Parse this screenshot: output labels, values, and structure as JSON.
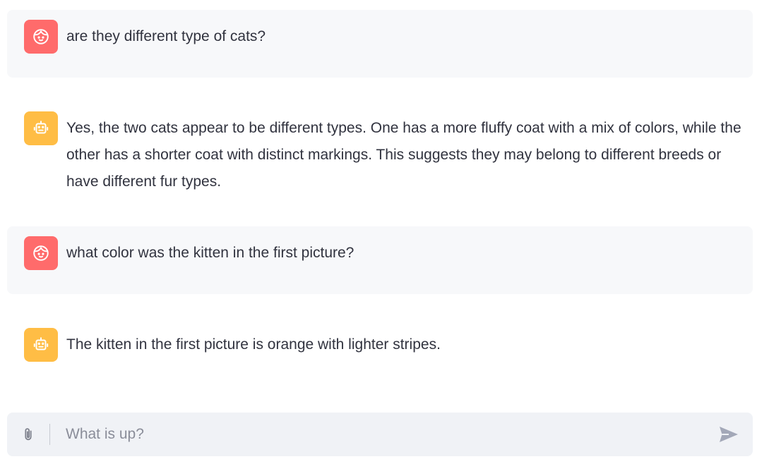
{
  "messages": [
    {
      "role": "user",
      "avatar_icon": "user-face-icon",
      "text": "are they different type of cats?"
    },
    {
      "role": "assistant",
      "avatar_icon": "robot-icon",
      "text": "Yes, the two cats appear to be different types. One has a more fluffy coat with a mix of colors, while the other has a shorter coat with distinct markings. This suggests they may belong to different breeds or have different fur types."
    },
    {
      "role": "user",
      "avatar_icon": "user-face-icon",
      "text": "what color was the kitten in the first picture?"
    },
    {
      "role": "assistant",
      "avatar_icon": "robot-icon",
      "text": "The kitten in the first picture is orange with lighter stripes."
    }
  ],
  "composer": {
    "placeholder": "What is up?",
    "value": "",
    "attach_icon": "paperclip-icon",
    "send_icon": "send-icon"
  },
  "colors": {
    "user_avatar": "#ff6b6b",
    "assistant_avatar": "#ffbd45",
    "user_bubble": "#f7f8fa",
    "composer_bg": "#f0f2f6"
  }
}
